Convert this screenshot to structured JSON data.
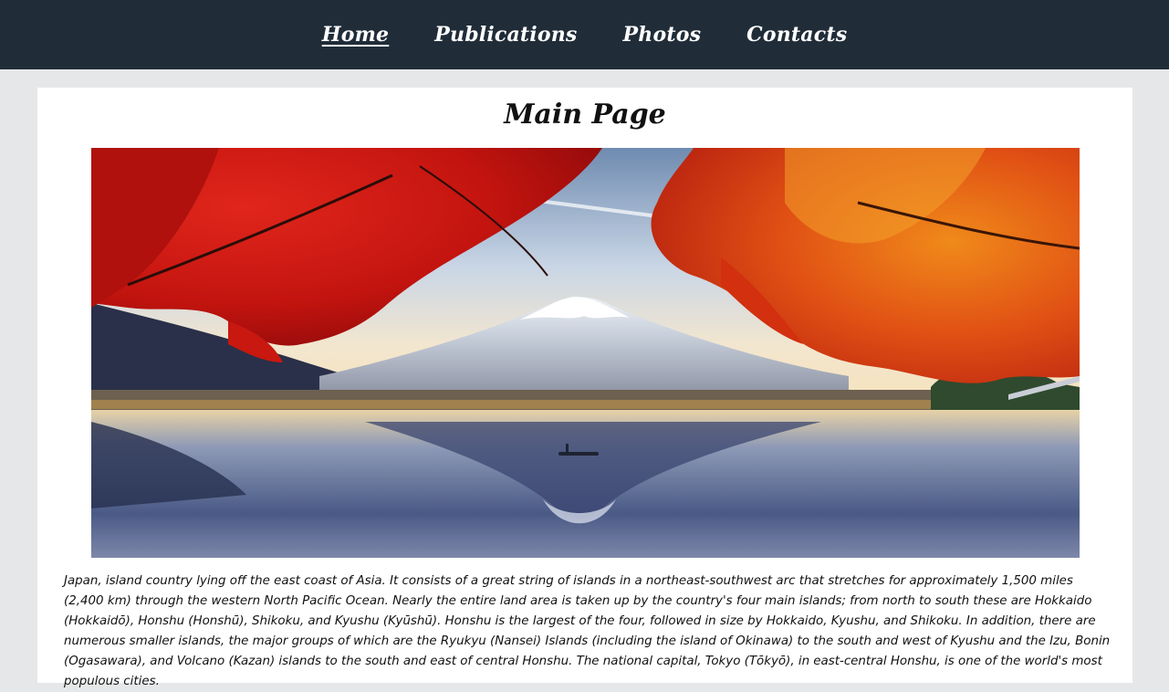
{
  "nav": {
    "items": [
      {
        "label": "Home",
        "active": true
      },
      {
        "label": "Publications",
        "active": false
      },
      {
        "label": "Photos",
        "active": false
      },
      {
        "label": "Contacts",
        "active": false
      }
    ]
  },
  "main": {
    "title": "Main Page",
    "hero_image": "mount-fuji-autumn-lake-photo",
    "paragraph": "Japan, island country lying off the east coast of Asia. It consists of a great string of islands in a northeast-southwest arc that stretches for approximately 1,500 miles (2,400 km) through the western North Pacific Ocean. Nearly the entire land area is taken up by the country's four main islands; from north to south these are Hokkaido (Hokkaidō), Honshu (Honshū), Shikoku, and Kyushu (Kyūshū). Honshu is the largest of the four, followed in size by Hokkaido, Kyushu, and Shikoku. In addition, there are numerous smaller islands, the major groups of which are the Ryukyu (Nansei) Islands (including the island of Okinawa) to the south and west of Kyushu and the Izu, Bonin (Ogasawara), and Volcano (Kazan) islands to the south and east of central Honshu. The national capital, Tokyo (Tōkyō), in east-central Honshu, is one of the world's most populous cities."
  },
  "colors": {
    "navbar": "#202d39",
    "page_bg": "#e6e7e8",
    "card_bg": "#ffffff"
  }
}
